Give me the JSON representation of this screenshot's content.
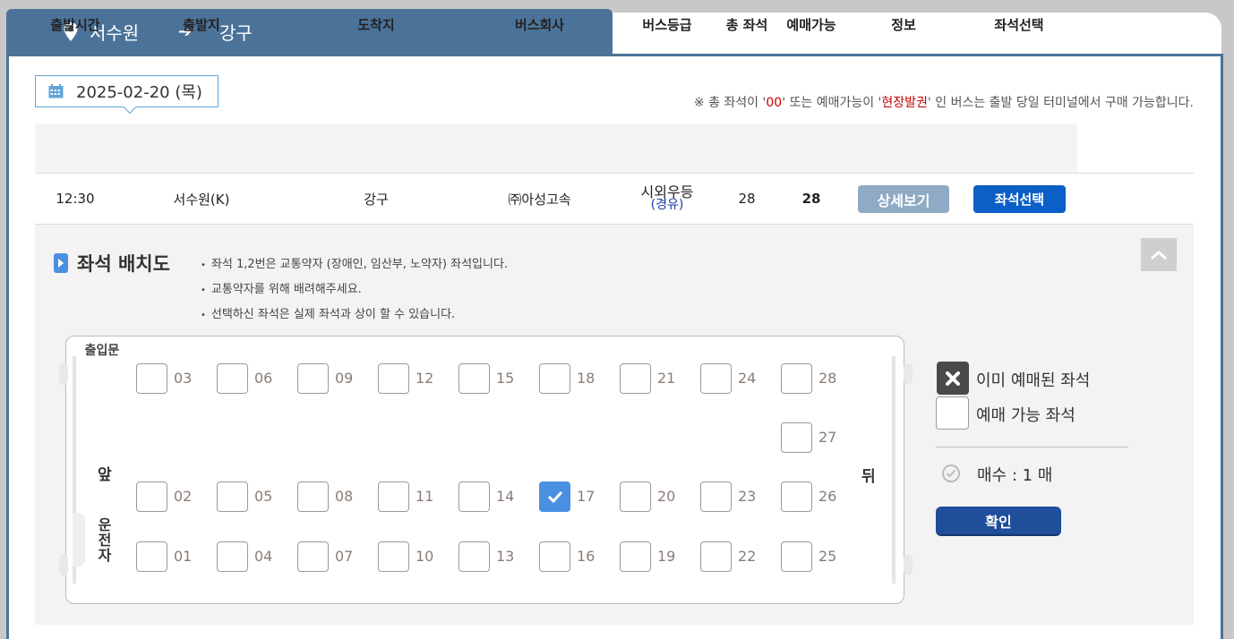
{
  "route": {
    "from": "서수원",
    "arrow": "➔",
    "to": "강구"
  },
  "date": "2025-02-20 (목)",
  "notice": {
    "p1": "※ 총 좌석이 '",
    "v1": "00",
    "p2": "' 또는 예매가능이 '",
    "v2": "현장발권",
    "p3": "' 인 버스는 출발 당일 터미널에서 구매 가능합니다."
  },
  "headers": [
    "출발시간",
    "출발지",
    "도착지",
    "버스회사",
    "버스등급",
    "총 좌석",
    "예매가능",
    "정보",
    "좌석선택"
  ],
  "row": {
    "time": "12:30",
    "from": "서수원(K)",
    "to": "강구",
    "company": "㈜아성고속",
    "grade": "시외우등",
    "grade_via": "(경유)",
    "total": "28",
    "available": "28",
    "detail_label": "상세보기",
    "select_label": "좌석선택"
  },
  "seatmap": {
    "title": "좌석 배치도",
    "notes": [
      "좌석 1,2번은 교통약자 (장애인, 임산부, 노약자) 좌석입니다.",
      "교통약자를 위해 배려해주세요.",
      "선택하신 좌석은 실제 좌석과 상이 할 수 있습니다."
    ],
    "door_label": "출입문",
    "front_label": "앞",
    "back_label": "뒤",
    "driver_label": "운전자",
    "selected_seat": "17",
    "rows": [
      [
        "03",
        "06",
        "09",
        "12",
        "15",
        "18",
        "21",
        "24",
        "28"
      ],
      [
        "",
        "",
        "",
        "",
        "",
        "",
        "",
        "",
        "27"
      ],
      [
        "02",
        "05",
        "08",
        "11",
        "14",
        "17",
        "20",
        "23",
        "26"
      ],
      [
        "01",
        "04",
        "07",
        "10",
        "13",
        "16",
        "19",
        "22",
        "25"
      ]
    ]
  },
  "legend": {
    "reserved": "이미 예매된 좌석",
    "available": "예매 가능 좌석",
    "count": "매수 : 1 매",
    "confirm": "확인"
  },
  "colors": {
    "header_blue": "#4b7399",
    "select_blue": "#0b5fc7",
    "detail_gray": "#8faac4",
    "seat_selected": "#4a90e2",
    "confirm_blue": "#1f4e9b"
  }
}
